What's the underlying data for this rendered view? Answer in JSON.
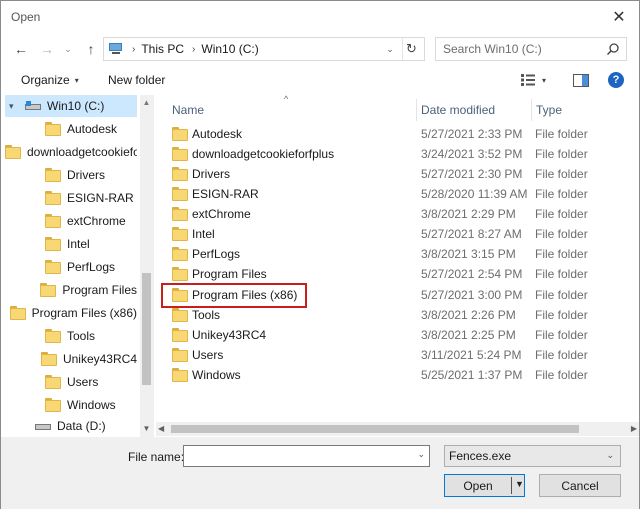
{
  "window": {
    "title": "Open",
    "close_glyph": "✕"
  },
  "nav": {
    "back_glyph": "←",
    "forward_glyph": "→",
    "recent_glyph": "⌄",
    "up_glyph": "↑"
  },
  "address": {
    "sep_glyph": "›",
    "crumbs": [
      "This PC",
      "Win10 (C:)"
    ],
    "dropdown_glyph": "⌄",
    "refresh_glyph": "↻"
  },
  "search": {
    "placeholder": "Search Win10 (C:)"
  },
  "toolbar": {
    "organize_label": "Organize",
    "caret_glyph": "▾",
    "new_folder_label": "New folder",
    "help_glyph": "?"
  },
  "sidebar": {
    "drive_c": "Win10 (C:)",
    "items": [
      "Autodesk",
      "downloadgetcookieforfplus",
      "Drivers",
      "ESIGN-RAR",
      "extChrome",
      "Intel",
      "PerfLogs",
      "Program Files",
      "Program Files (x86)",
      "Tools",
      "Unikey43RC4",
      "Users",
      "Windows"
    ],
    "drive_d": "Data (D:)"
  },
  "columns": {
    "sort_glyph": "^",
    "name": "Name",
    "date": "Date modified",
    "type": "Type"
  },
  "files": [
    {
      "name": "Autodesk",
      "date": "5/27/2021 2:33 PM",
      "type": "File folder"
    },
    {
      "name": "downloadgetcookieforfplus",
      "date": "3/24/2021 3:52 PM",
      "type": "File folder"
    },
    {
      "name": "Drivers",
      "date": "5/27/2021 2:30 PM",
      "type": "File folder"
    },
    {
      "name": "ESIGN-RAR",
      "date": "5/28/2020 11:39 AM",
      "type": "File folder"
    },
    {
      "name": "extChrome",
      "date": "3/8/2021 2:29 PM",
      "type": "File folder"
    },
    {
      "name": "Intel",
      "date": "5/27/2021 8:27 AM",
      "type": "File folder"
    },
    {
      "name": "PerfLogs",
      "date": "3/8/2021 3:15 PM",
      "type": "File folder"
    },
    {
      "name": "Program Files",
      "date": "5/27/2021 2:54 PM",
      "type": "File folder"
    },
    {
      "name": "Program Files (x86)",
      "date": "5/27/2021 3:00 PM",
      "type": "File folder"
    },
    {
      "name": "Tools",
      "date": "3/8/2021 2:26 PM",
      "type": "File folder"
    },
    {
      "name": "Unikey43RC4",
      "date": "3/8/2021 2:25 PM",
      "type": "File folder"
    },
    {
      "name": "Users",
      "date": "3/11/2021 5:24 PM",
      "type": "File folder"
    },
    {
      "name": "Windows",
      "date": "5/25/2021 1:37 PM",
      "type": "File folder"
    }
  ],
  "highlighted_item": "Program Files (x86)",
  "bottom": {
    "file_name_label": "File name:",
    "file_name_value": "",
    "filter_value": "Fences.exe",
    "open_label": "Open",
    "cancel_label": "Cancel",
    "dropdown_glyph": "⌄"
  },
  "colors": {
    "selection": "#cce8ff",
    "highlight_border": "#c81e1e",
    "folder": "#f8d775",
    "accent": "#0078d7",
    "help": "#1e65c2"
  },
  "icons": {
    "navigation": [
      "back-arrow-icon",
      "forward-arrow-icon",
      "up-arrow-icon",
      "refresh-icon",
      "search-icon"
    ],
    "toolbar": [
      "view-options-icon",
      "preview-pane-icon",
      "help-icon"
    ],
    "items": [
      "folder-icon",
      "drive-icon"
    ]
  }
}
